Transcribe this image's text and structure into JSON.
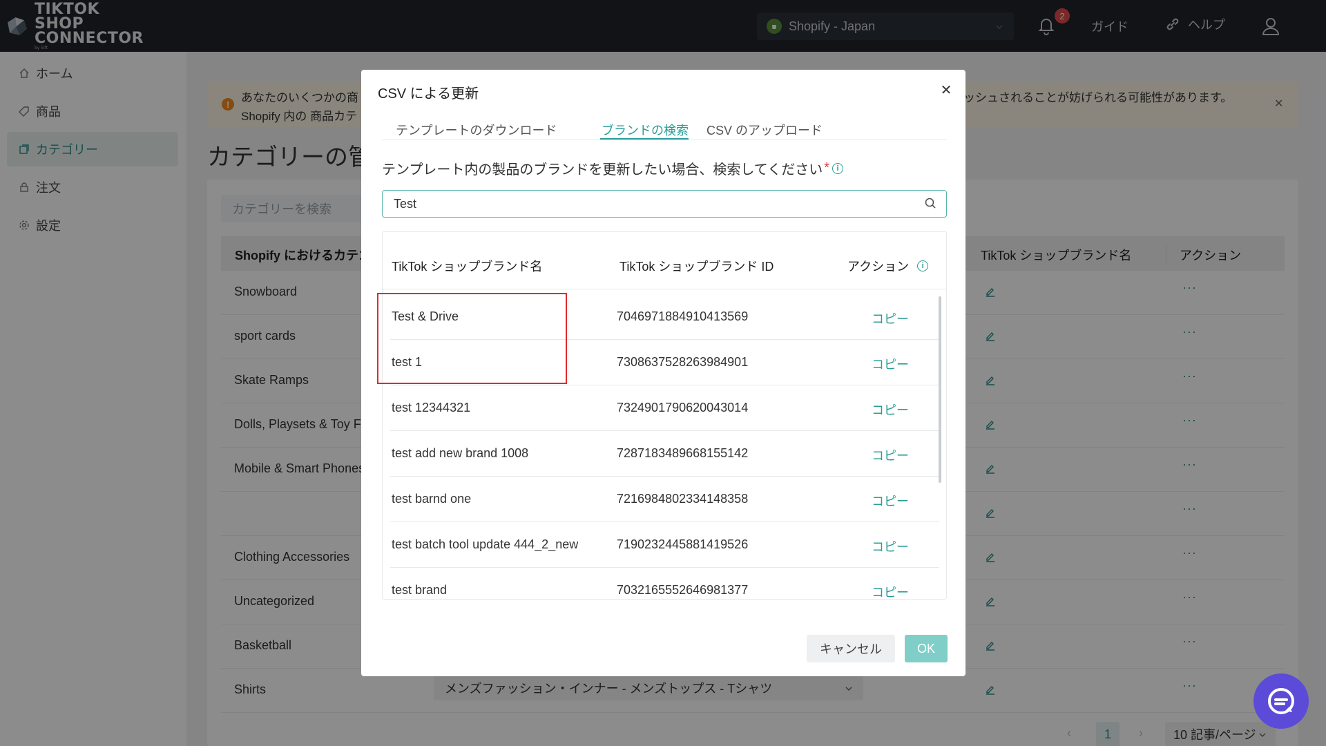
{
  "header": {
    "logo_line1": "TIKTOK SHOP",
    "logo_line2": "CONNECTOR",
    "logo_by": "by Sift",
    "store": "Shopify - Japan",
    "notification_count": "2",
    "guide": "ガイド",
    "help": "ヘルプ"
  },
  "sidebar": {
    "items": [
      {
        "label": "ホーム",
        "icon": "home-icon"
      },
      {
        "label": "商品",
        "icon": "tag-icon"
      },
      {
        "label": "カテゴリー",
        "icon": "category-icon"
      },
      {
        "label": "注文",
        "icon": "lock-icon"
      },
      {
        "label": "設定",
        "icon": "gear-icon"
      }
    ],
    "active_index": 2
  },
  "alert": {
    "line1_start": "あなたのいくつかの商",
    "line1_end": "ッシュされることが妨げられる可能性があります。",
    "line2": "Shopify 内の 商品カテ"
  },
  "page": {
    "title": "カテゴリーの管",
    "search_placeholder": "カテゴリーを検索",
    "col_shopify": "Shopify におけるカテゴ",
    "col_tiktok_brand": "TikTok ショップブランド名",
    "col_action": "アクション",
    "rows": [
      "Snowboard",
      "sport cards",
      "Skate Ramps",
      "Dolls, Playsets & Toy Fig",
      "Mobile & Smart Phones",
      "",
      "Clothing Accessories",
      "Uncategorized",
      "Basketball",
      "Shirts"
    ],
    "shirts_category": "メンズファッション・インナー - メンズトップス - Tシャツ",
    "pager_current": "1",
    "pager_size": "10 記事/ページ"
  },
  "modal": {
    "title": "CSV による更新",
    "tabs": [
      "テンプレートのダウンロード",
      "ブランドの検索",
      "CSV のアップロード"
    ],
    "active_tab": 1,
    "label": "テンプレート内の製品のブランドを更新したい場合、検索してください",
    "required_mark": "*",
    "search_value": "Test",
    "table": {
      "col_name": "TikTok ショップブランド名",
      "col_id": "TikTok ショップブランド ID",
      "col_action": "アクション",
      "rows": [
        {
          "name": "Test & Drive",
          "id": "7046971884910413569",
          "action": "コピー"
        },
        {
          "name": "test 1",
          "id": "7308637528263984901",
          "action": "コピー"
        },
        {
          "name": "test 12344321",
          "id": "7324901790620043014",
          "action": "コピー"
        },
        {
          "name": "test add new brand 1008",
          "id": "7287183489668155142",
          "action": "コピー"
        },
        {
          "name": "test barnd one",
          "id": "7216984802334148358",
          "action": "コピー"
        },
        {
          "name": "test batch tool update 444_2_new",
          "id": "7190232445881419526",
          "action": "コピー"
        },
        {
          "name": "test brand",
          "id": "7032165552646981377",
          "action": "コピー"
        }
      ]
    },
    "cancel": "キャンセル",
    "ok": "OK"
  },
  "colors": {
    "accent": "#2a9d97",
    "header_bg": "#1f2329",
    "highlight": "#e02a2a",
    "chat": "#5b4bd8"
  }
}
